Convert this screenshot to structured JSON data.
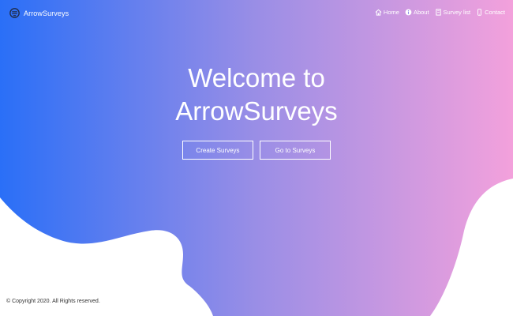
{
  "navbar": {
    "brand": "ArrowSurveys",
    "links": [
      {
        "label": "Home",
        "icon": "home-icon"
      },
      {
        "label": "About",
        "icon": "info-icon"
      },
      {
        "label": "Survey list",
        "icon": "book-icon"
      },
      {
        "label": "Contact",
        "icon": "mobile-phone-icon"
      }
    ]
  },
  "hero": {
    "title_line1": "Welcome to",
    "title_line2": "ArrowSurveys",
    "buttons": {
      "create": "Create Surveys",
      "goto": "Go to Surveys"
    }
  },
  "footer": {
    "copyright": "© Copyright 2020. All Rights reserved."
  },
  "colors": {
    "gradient_start": "#2a6ff7",
    "gradient_mid": "#9a8ee6",
    "gradient_end": "#f3a1dc",
    "background": "#ffffff",
    "text_light": "#ffffff",
    "footer_text": "#333333"
  }
}
